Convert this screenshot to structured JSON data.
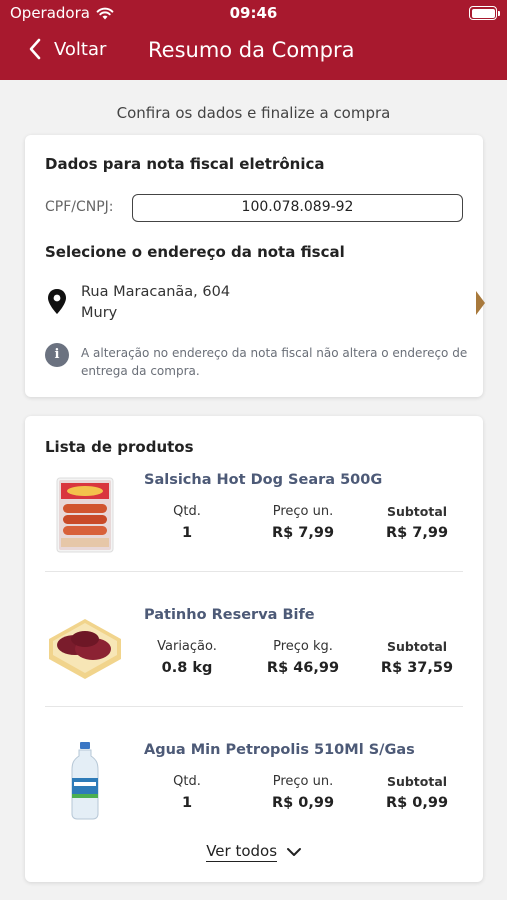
{
  "status_bar": {
    "carrier": "Operadora",
    "time": "09:46"
  },
  "header": {
    "back_label": "Voltar",
    "title": "Resumo da Compra"
  },
  "subtitle": "Confira os dados e finalize a compra",
  "invoice": {
    "heading": "Dados para nota fiscal eletrônica",
    "cpf_label": "CPF/CNPJ:",
    "cpf_value": "100.078.089-92",
    "address_heading": "Selecione o endereço da nota fiscal",
    "address_line1": "Rua Maracanãa, 604",
    "address_line2": "Mury",
    "info_text": "A alteração no endereço da nota fiscal não altera o endereço de entrega da compra."
  },
  "products": {
    "heading": "Lista de produtos",
    "items": [
      {
        "name": "Salsicha Hot Dog Seara 500G",
        "col1_label": "Qtd.",
        "col1_value": "1",
        "col2_label": "Preço un.",
        "col2_value": "R$ 7,99",
        "subtotal_label": "Subtotal",
        "subtotal_value": "R$ 7,99"
      },
      {
        "name": "Patinho Reserva Bife",
        "col1_label": "Variação.",
        "col1_value": "0.8 kg",
        "col2_label": "Preço kg.",
        "col2_value": "R$ 46,99",
        "subtotal_label": "Subtotal",
        "subtotal_value": "R$ 37,59"
      },
      {
        "name": "Agua Min Petropolis 510Ml S/Gas",
        "col1_label": "Qtd.",
        "col1_value": "1",
        "col2_label": "Preço un.",
        "col2_value": "R$ 0,99",
        "subtotal_label": "Subtotal",
        "subtotal_value": "R$ 0,99"
      }
    ],
    "see_all_label": "Ver todos"
  },
  "colors": {
    "brand": "#a8192e",
    "arrow": "#a8793c",
    "product_name": "#4d5a77"
  }
}
